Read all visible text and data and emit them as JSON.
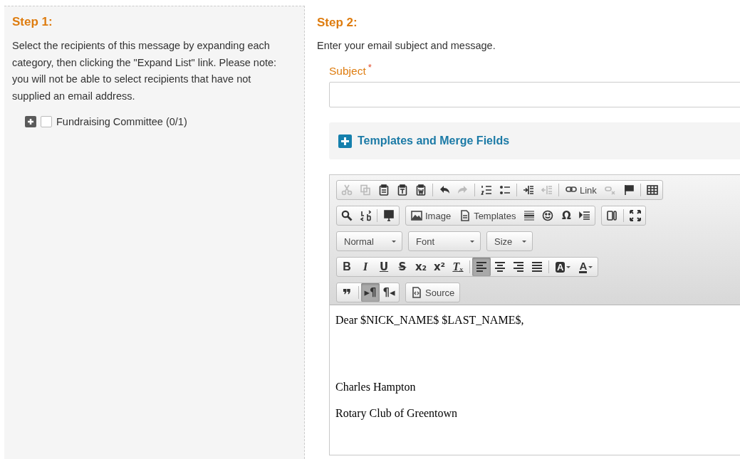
{
  "step1": {
    "title": "Step 1:",
    "instructions": "Select the recipients of this message by expanding each category, then clicking the \"Expand List\" link. Please note: you will not be able to select recipients that have not supplied an email address.",
    "categories": [
      {
        "label": "Fundraising Committee (0/1)",
        "checked": false,
        "expanded": false
      }
    ]
  },
  "step2": {
    "title": "Step 2:",
    "instructions": "Enter your email subject and message.",
    "subject": {
      "label": "Subject",
      "required_mark": "*"
    },
    "templates_panel": {
      "label": "Templates and Merge Fields",
      "expanded": false
    },
    "toolbar": [
      [
        {
          "sections": [
            [
              {
                "kind": "icon",
                "disabled": true
              },
              {
                "kind": "icon",
                "disabled": true
              },
              {
                "kind": "icon",
                "disabled": false
              },
              {
                "kind": "icon",
                "disabled": false
              },
              {
                "kind": "icon",
                "disabled": false
              }
            ],
            [
              {
                "kind": "icon",
                "disabled": false
              },
              {
                "kind": "icon",
                "disabled": true
              }
            ],
            [
              {
                "kind": "icon",
                "disabled": false
              },
              {
                "kind": "icon",
                "disabled": false
              }
            ],
            [
              {
                "kind": "icon",
                "disabled": false
              },
              {
                "kind": "icon",
                "disabled": true
              }
            ],
            [
              {
                "kind": "text",
                "label": "Link",
                "disabled": false
              },
              {
                "kind": "icon",
                "disabled": true
              },
              {
                "kind": "icon",
                "disabled": false
              }
            ],
            [
              {
                "kind": "icon",
                "disabled": false
              }
            ]
          ]
        }
      ],
      [
        {
          "sections": [
            [
              {
                "kind": "icon",
                "disabled": false
              },
              {
                "kind": "icon",
                "disabled": false
              }
            ],
            [
              {
                "kind": "icon",
                "disabled": false
              }
            ]
          ]
        },
        {
          "sections": [
            [
              {
                "kind": "text",
                "label": "Image",
                "disabled": false
              },
              {
                "kind": "text",
                "label": "Templates",
                "disabled": false
              },
              {
                "kind": "icon",
                "disabled": false
              },
              {
                "kind": "icon",
                "disabled": false
              },
              {
                "kind": "glyph",
                "label": "Ω",
                "disabled": false
              },
              {
                "kind": "icon",
                "disabled": false
              }
            ]
          ]
        },
        {
          "sections": [
            [
              {
                "kind": "icon",
                "disabled": false
              }
            ],
            [
              {
                "kind": "icon",
                "disabled": false
              }
            ]
          ]
        }
      ],
      [
        {
          "kind": "combo",
          "label": "Normal"
        },
        {
          "kind": "combo",
          "label": "Font"
        },
        {
          "kind": "combo",
          "label": "Size"
        }
      ],
      [
        {
          "sections": [
            [
              {
                "kind": "glyph",
                "label": "B",
                "disabled": false
              },
              {
                "kind": "glyph",
                "label": "I",
                "disabled": false
              },
              {
                "kind": "glyph",
                "label": "U",
                "disabled": false
              },
              {
                "kind": "glyph",
                "label": "S",
                "disabled": false
              },
              {
                "kind": "glyph",
                "label": "x₂",
                "disabled": false
              },
              {
                "kind": "glyph",
                "label": "x²",
                "disabled": false
              },
              {
                "kind": "glyph",
                "label": "Tₓ",
                "disabled": false
              }
            ],
            [
              {
                "kind": "icon",
                "disabled": false,
                "on": true
              },
              {
                "kind": "icon",
                "disabled": false,
                "on": false
              },
              {
                "kind": "icon",
                "disabled": false,
                "on": false
              },
              {
                "kind": "icon",
                "disabled": false,
                "on": false
              }
            ],
            [
              {
                "kind": "color",
                "label": "A",
                "disabled": false
              },
              {
                "kind": "color",
                "label": "A",
                "disabled": false
              }
            ]
          ]
        }
      ],
      [
        {
          "sections": [
            [
              {
                "kind": "glyph",
                "label": "❞",
                "disabled": false
              }
            ],
            [
              {
                "kind": "glyph",
                "label": "▸¶",
                "disabled": false,
                "on": true
              },
              {
                "kind": "glyph",
                "label": "¶◂",
                "disabled": false,
                "on": false
              }
            ]
          ]
        },
        {
          "sections": [
            [
              {
                "kind": "text",
                "label": "Source",
                "disabled": false
              }
            ]
          ]
        }
      ]
    ],
    "body": [
      {
        "kind": "text",
        "text": "Dear $NICK_NAME$ $LAST_NAME$,"
      },
      {
        "kind": "blank"
      },
      {
        "kind": "text",
        "text": "Charles Hampton"
      },
      {
        "kind": "text",
        "text": "Rotary Club of Greentown"
      }
    ]
  }
}
